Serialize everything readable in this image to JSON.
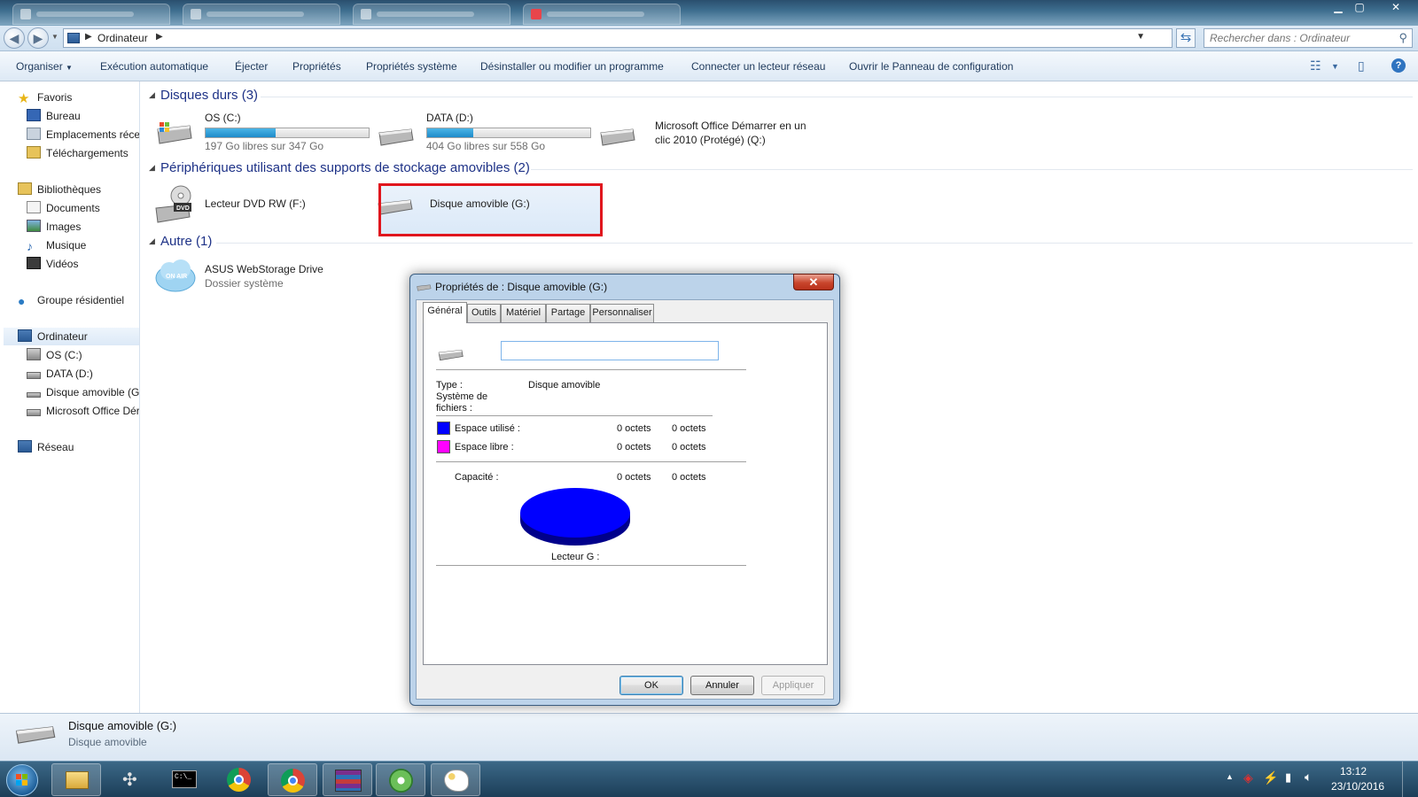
{
  "explorer": {
    "address": {
      "location": "Ordinateur",
      "search_placeholder": "Rechercher dans : Ordinateur"
    },
    "command_bar": {
      "organize": "Organiser",
      "autoplay": "Exécution automatique",
      "eject": "Éjecter",
      "properties": "Propriétés",
      "system_properties": "Propriétés système",
      "uninstall": "Désinstaller ou modifier un programme",
      "map_drive": "Connecter un lecteur réseau",
      "control_panel": "Ouvrir le Panneau de configuration"
    },
    "nav": {
      "favorites": "Favoris",
      "desktop": "Bureau",
      "recent": "Emplacements récer",
      "downloads": "Téléchargements",
      "libraries": "Bibliothèques",
      "documents": "Documents",
      "images": "Images",
      "music": "Musique",
      "videos": "Vidéos",
      "homegroup": "Groupe résidentiel",
      "computer": "Ordinateur",
      "os_c": "OS (C:)",
      "data_d": "DATA (D:)",
      "removable_g": "Disque amovible (G:",
      "office": "Microsoft Office Dér",
      "network": "Réseau"
    },
    "groups": {
      "hard_disks": "Disques durs (3)",
      "removable": "Périphériques utilisant des supports de stockage amovibles (2)",
      "other": "Autre (1)"
    },
    "drives": {
      "c": {
        "name": "OS (C:)",
        "free": "197 Go libres sur 347 Go",
        "used_fraction": 0.43
      },
      "d": {
        "name": "DATA (D:)",
        "free": "404 Go libres sur 558 Go",
        "used_fraction": 0.28
      },
      "q": {
        "name1": "Microsoft Office Démarrer en un",
        "name2": "clic 2010 (Protégé) (Q:)"
      },
      "f": {
        "name": "Lecteur DVD RW (F:)"
      },
      "g": {
        "name": "Disque amovible (G:)"
      },
      "asus": {
        "name": "ASUS WebStorage Drive",
        "sub": "Dossier système"
      }
    },
    "details": {
      "name": "Disque amovible (G:)",
      "type": "Disque amovible"
    }
  },
  "dialog": {
    "title": "Propriétés de : Disque amovible (G:)",
    "tabs": [
      "Général",
      "Outils",
      "Matériel",
      "Partage",
      "Personnaliser"
    ],
    "type_label": "Type :",
    "type_value": "Disque amovible",
    "fs_label1": "Système de",
    "fs_label2": "fichiers :",
    "used_label": "Espace utilisé :",
    "used_bytes": "0 octets",
    "used_size": "0 octets",
    "free_label": "Espace libre :",
    "free_bytes": "0 octets",
    "free_size": "0 octets",
    "capacity_label": "Capacité :",
    "capacity_bytes": "0 octets",
    "capacity_size": "0 octets",
    "drive_caption": "Lecteur G :",
    "ok": "OK",
    "cancel": "Annuler",
    "apply": "Appliquer",
    "colors": {
      "used": "#0000ff",
      "free": "#ff00ff"
    }
  },
  "taskbar": {
    "time": "13:12",
    "date": "23/10/2016"
  }
}
